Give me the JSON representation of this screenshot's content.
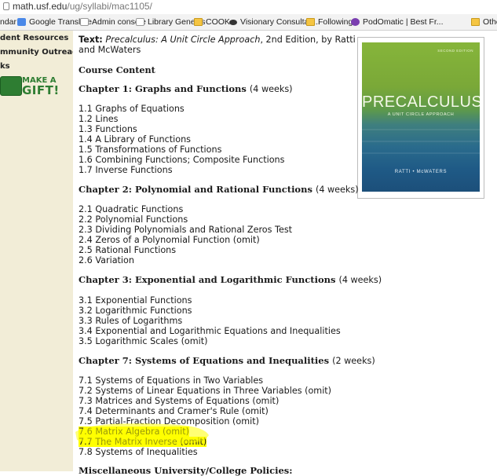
{
  "browser": {
    "url_host": "math.usf.edu",
    "url_path": "/ug/syllabi/mac1105/"
  },
  "bookmarks": [
    {
      "label": "ndar",
      "icon": "page-icon"
    },
    {
      "label": "Google Translate",
      "icon": "google-translate-icon"
    },
    {
      "label": "Admin console",
      "icon": "page-icon"
    },
    {
      "label": "Library Genesis",
      "icon": "page-icon"
    },
    {
      "label": "COOK",
      "icon": "folder-icon"
    },
    {
      "label": "Visionary Consultan...",
      "icon": "eye-icon"
    },
    {
      "label": "Following",
      "icon": "folder-icon"
    },
    {
      "label": "PodOmatic | Best Fr...",
      "icon": "podomatic-icon"
    },
    {
      "label": "Othe",
      "icon": "folder-icon"
    }
  ],
  "sidebar": {
    "items": [
      "dent Resources",
      "mmunity Outreach",
      "ks"
    ],
    "gift": {
      "make": "MAKE A",
      "gift": "GIFT!"
    }
  },
  "text": {
    "label": "Text:",
    "title": "Precalculus: A Unit Circle Approach",
    "rest1": ", 2nd Edition, by Ratti",
    "rest2": "and McWaters"
  },
  "course_content_heading": "Course Content",
  "chapters": [
    {
      "title": "Chapter 1: Graphs and Functions",
      "duration": "(4 weeks)",
      "sections": [
        "1.1 Graphs of Equations",
        "1.2 Lines",
        "1.3 Functions",
        "1.4 A Library of Functions",
        "1.5 Transformations of Functions",
        "1.6 Combining Functions; Composite Functions",
        "1.7 Inverse Functions"
      ]
    },
    {
      "title": "Chapter 2: Polynomial and Rational Functions",
      "duration": "(4 weeks)",
      "sections": [
        "2.1 Quadratic Functions",
        "2.2 Polynomial Functions",
        "2.3 Dividing Polynomials and Rational Zeros Test",
        "2.4 Zeros of a Polynomial Function (omit)",
        "2.5 Rational Functions",
        "2.6 Variation"
      ]
    },
    {
      "title": "Chapter 3: Exponential and Logarithmic Functions",
      "duration": "(4 weeks)",
      "sections": [
        "3.1 Exponential Functions",
        "3.2 Logarithmic Functions",
        "3.3 Rules of Logarithms",
        "3.4 Exponential and Logarithmic Equations and Inequalities",
        "3.5 Logarithmic Scales (omit)"
      ]
    },
    {
      "title": "Chapter 7: Systems of Equations and Inequalities",
      "duration": "(2 weeks)",
      "sections": [
        "7.1 Systems of Equations in Two Variables",
        "7.2 Systems of Linear Equations in Three Variables (omit)",
        "7.3 Matrices and Systems of Equations (omit)",
        "7.4 Determinants and Cramer's Rule (omit)",
        "7.5 Partial-Fraction Decomposition (omit)",
        "7.6 Matrix Algebra (omit)",
        "7.7 The Matrix Inverse (omit)",
        "7.8 Systems of Inequalities"
      ]
    }
  ],
  "next_heading": "Miscellaneous University/College Policies:",
  "highlight_color": "#ffff00",
  "book_cover": {
    "edition": "SECOND EDITION",
    "title": "PRECALCULUS",
    "subtitle": "A UNIT CIRCLE APPROACH",
    "authors": "RATTI • McWATERS"
  }
}
